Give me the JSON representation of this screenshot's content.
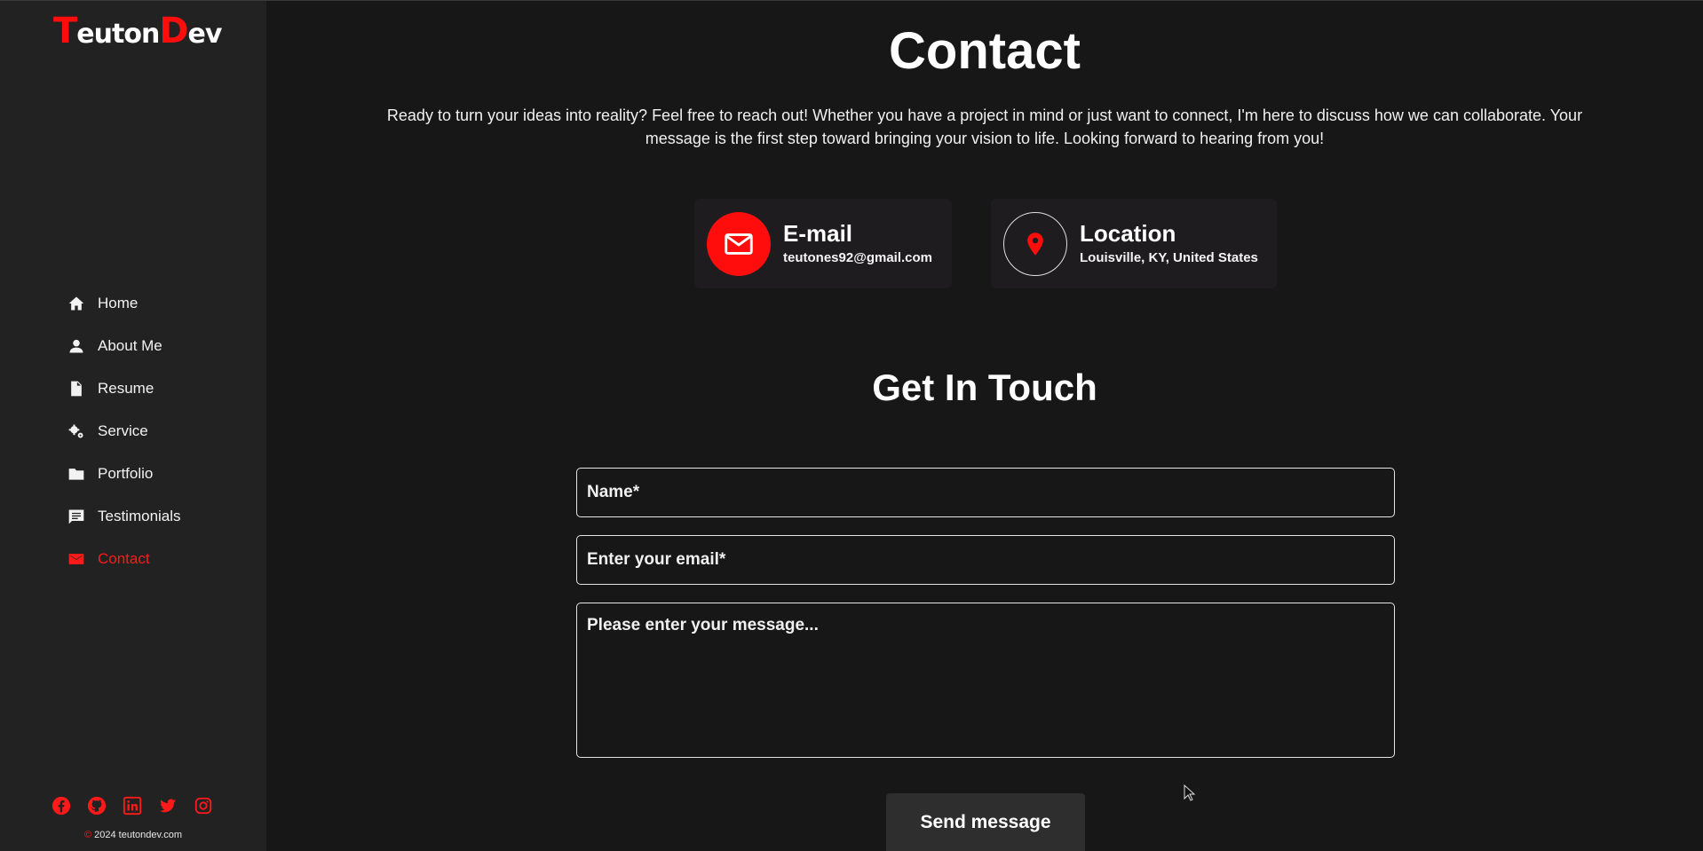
{
  "brand": {
    "logo_first_letter": "T",
    "logo_mid": "euton",
    "logo_second_letter": "D",
    "logo_end": "ev"
  },
  "sidebar": {
    "items": [
      {
        "label": "Home",
        "icon": "home-icon",
        "active": false
      },
      {
        "label": "About Me",
        "icon": "person-icon",
        "active": false
      },
      {
        "label": "Resume",
        "icon": "document-icon",
        "active": false
      },
      {
        "label": "Service",
        "icon": "gears-icon",
        "active": false
      },
      {
        "label": "Portfolio",
        "icon": "folder-icon",
        "active": false
      },
      {
        "label": "Testimonials",
        "icon": "comment-icon",
        "active": false
      },
      {
        "label": "Contact",
        "icon": "mail-icon",
        "active": true
      }
    ],
    "socials": [
      "facebook-icon",
      "github-icon",
      "linkedin-icon",
      "twitter-icon",
      "instagram-icon"
    ],
    "copyright_symbol": "©",
    "copyright_text": " 2024 teutondev.com"
  },
  "main": {
    "title": "Contact",
    "intro": "Ready to turn your ideas into reality? Feel free to reach out! Whether you have a project in mind or just want to connect, I'm here to discuss how we can collaborate. Your message is the first step toward bringing your vision to life. Looking forward to hearing from you!",
    "email_card": {
      "title": "E-mail",
      "value": "teutones92@gmail.com"
    },
    "location_card": {
      "title": "Location",
      "value": "Louisville, KY, United States"
    },
    "form": {
      "heading": "Get In Touch",
      "name_placeholder": "Name*",
      "email_placeholder": "Enter your email*",
      "message_placeholder": "Please enter your message...",
      "send_label": "Send message"
    }
  },
  "colors": {
    "accent": "#ff0d0d",
    "background": "#171717",
    "sidebar": "#222222",
    "card": "#1e1c1f",
    "button": "#2e2e2e"
  }
}
